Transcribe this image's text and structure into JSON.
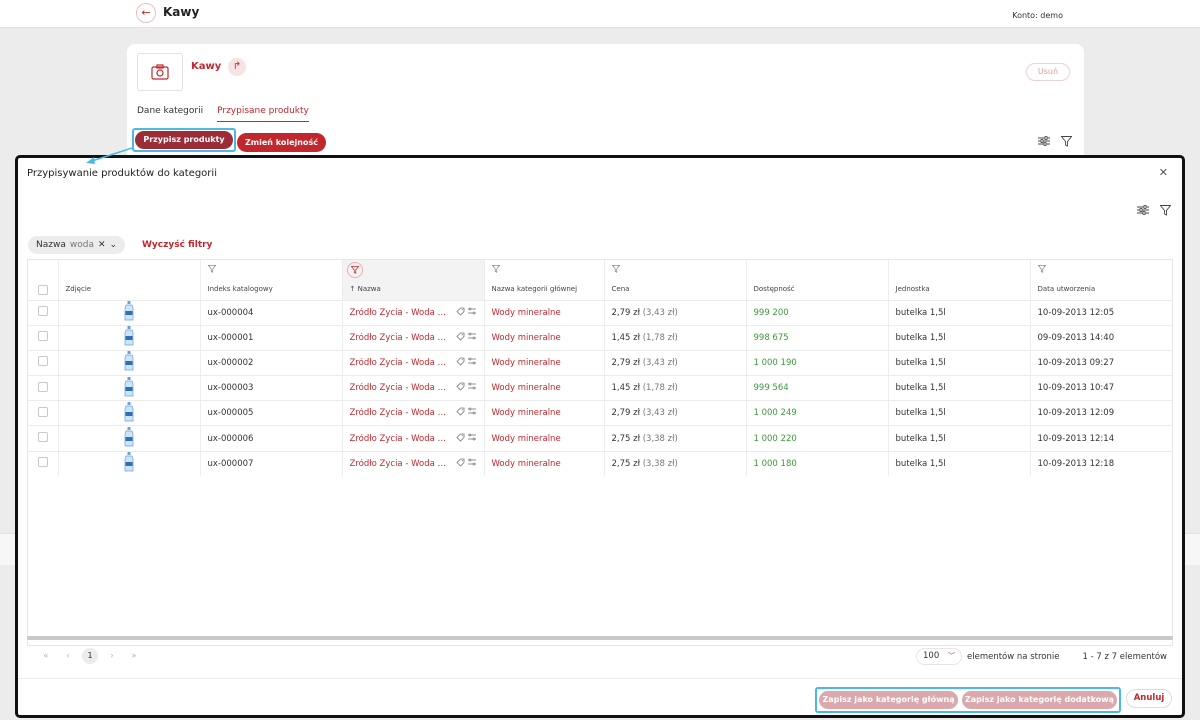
{
  "page": {
    "title": "Kawy",
    "account": "Konto: demo",
    "category_name": "Kawy",
    "delete_label": "Usuń",
    "tabs": [
      {
        "label": "Dane kategorii"
      },
      {
        "label": "Przypisane produkty"
      }
    ],
    "assign_label": "Przypisz produkty",
    "order_label": "Zmień kolejność"
  },
  "modal": {
    "title": "Przypisywanie produktów do kategorii",
    "filter_chip": {
      "field": "Nazwa",
      "value": "woda"
    },
    "clear_filters": "Wyczyść filtry",
    "columns": [
      "Zdjęcie",
      "Indeks katalogowy",
      "↑ Nazwa",
      "Nazwa kategorii głównej",
      "Cena",
      "Dostępność",
      "Jednostka",
      "Data utworzenia"
    ],
    "rows": [
      {
        "index": "ux-000004",
        "name": "Źródło Życia - Woda min...",
        "category": "Wody mineralne",
        "price": "2,79 zł",
        "price_gross": "(3,43 zł)",
        "availability": "999 200",
        "unit": "butelka 1,5l",
        "created": "10-09-2013 12:05"
      },
      {
        "index": "ux-000001",
        "name": "Źródło Życia - Woda min...",
        "category": "Wody mineralne",
        "price": "1,45 zł",
        "price_gross": "(1,78 zł)",
        "availability": "998 675",
        "unit": "butelka 1,5l",
        "created": "09-09-2013 14:40"
      },
      {
        "index": "ux-000002",
        "name": "Źródło Życia - Woda min...",
        "category": "Wody mineralne",
        "price": "2,79 zł",
        "price_gross": "(3,43 zł)",
        "availability": "1 000 190",
        "unit": "butelka 1,5l",
        "created": "10-09-2013 09:27"
      },
      {
        "index": "ux-000003",
        "name": "Źródło Życia - Woda min...",
        "category": "Wody mineralne",
        "price": "1,45 zł",
        "price_gross": "(1,78 zł)",
        "availability": "999 564",
        "unit": "butelka 1,5l",
        "created": "10-09-2013 10:47"
      },
      {
        "index": "ux-000005",
        "name": "Źródło Życia - Woda min...",
        "category": "Wody mineralne",
        "price": "2,79 zł",
        "price_gross": "(3,43 zł)",
        "availability": "1 000 249",
        "unit": "butelka 1,5l",
        "created": "10-09-2013 12:09"
      },
      {
        "index": "ux-000006",
        "name": "Źródło Życia - Woda min...",
        "category": "Wody mineralne",
        "price": "2,75 zł",
        "price_gross": "(3,38 zł)",
        "availability": "1 000 220",
        "unit": "butelka 1,5l",
        "created": "10-09-2013 12:14"
      },
      {
        "index": "ux-000007",
        "name": "Źródło Życia - Woda min...",
        "category": "Wody mineralne",
        "price": "2,75 zł",
        "price_gross": "(3,38 zł)",
        "availability": "1 000 180",
        "unit": "butelka 1,5l",
        "created": "10-09-2013 12:18"
      }
    ],
    "pagination": {
      "current_page": "1",
      "per_page": "100",
      "per_page_label": "elementów na stronie",
      "range": "1 - 7 z 7 elementów"
    },
    "save_main_label": "Zapisz jako kategorię główną",
    "save_extra_label": "Zapisz jako kategorię dodatkową",
    "cancel_label": "Anuluj"
  },
  "colors": {
    "accent": "#c0282d",
    "accent_dark": "#9b2d38",
    "highlight": "#4bb9e6",
    "success": "#3a9a3a"
  },
  "icons": [
    "back-arrow-icon",
    "camera-icon",
    "share-icon",
    "settings-sliders-icon",
    "filter-icon",
    "close-icon",
    "bottle-icon",
    "tag-icon",
    "compare-icon",
    "chevron-icon"
  ]
}
